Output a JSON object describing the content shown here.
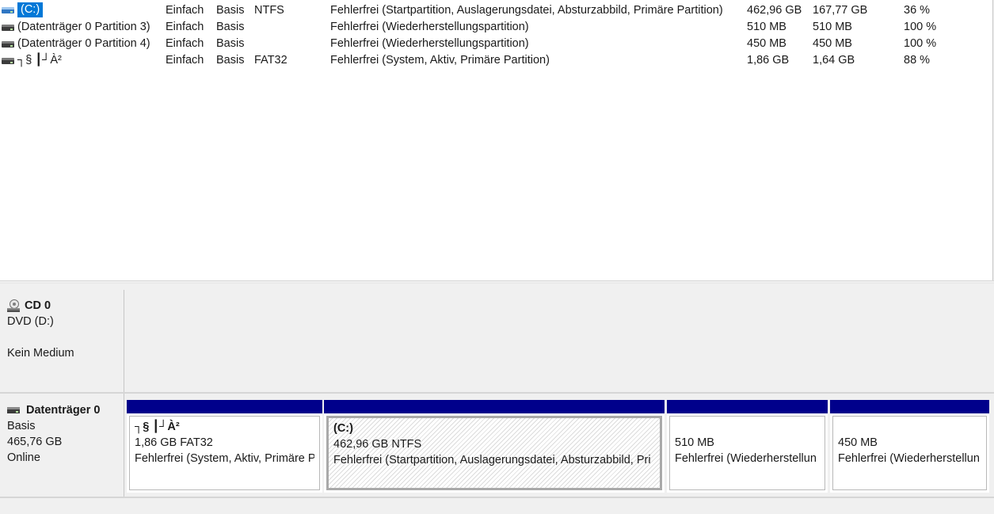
{
  "volumes": [
    {
      "name": "(C:)",
      "layout": "Einfach",
      "type": "Basis",
      "fs": "NTFS",
      "status": "Fehlerfrei (Startpartition, Auslagerungsdatei, Absturzabbild, Primäre Partition)",
      "capacity": "462,96 GB",
      "free": "167,77 GB",
      "pct": "36 %"
    },
    {
      "name": "(Datenträger 0 Partition 3)",
      "layout": "Einfach",
      "type": "Basis",
      "fs": "",
      "status": "Fehlerfrei (Wiederherstellungspartition)",
      "capacity": "510 MB",
      "free": "510 MB",
      "pct": "100 %"
    },
    {
      "name": "(Datenträger 0 Partition 4)",
      "layout": "Einfach",
      "type": "Basis",
      "fs": "",
      "status": "Fehlerfrei (Wiederherstellungspartition)",
      "capacity": "450 MB",
      "free": "450 MB",
      "pct": "100 %"
    },
    {
      "name": "┐§ ┃┘À²",
      "layout": "Einfach",
      "type": "Basis",
      "fs": "FAT32",
      "status": "Fehlerfrei (System, Aktiv, Primäre Partition)",
      "capacity": "1,86 GB",
      "free": "1,64 GB",
      "pct": "88 %"
    }
  ],
  "cd": {
    "title": "CD 0",
    "drive": "DVD (D:)",
    "media": "Kein Medium",
    "icon": "cd-drive-icon"
  },
  "disk0": {
    "title": "Datenträger 0",
    "type": "Basis",
    "size": "465,76 GB",
    "state": "Online",
    "icon": "hard-disk-icon"
  },
  "partitions": [
    {
      "name": "┐§ ┃┘À²",
      "size": "1,86 GB FAT32",
      "status": "Fehlerfrei (System, Aktiv, Primäre P"
    },
    {
      "name": "(C:)",
      "size": "462,96 GB NTFS",
      "status": "Fehlerfrei (Startpartition, Auslagerungsdatei, Absturzabbild, Pri"
    },
    {
      "name": "",
      "size": "510 MB",
      "status": "Fehlerfrei (Wiederherstellun"
    },
    {
      "name": "",
      "size": "450 MB",
      "status": "Fehlerfrei (Wiederherstellun"
    }
  ],
  "colors": {
    "partition_bar": "#00008b",
    "selection": "#0078d7"
  }
}
